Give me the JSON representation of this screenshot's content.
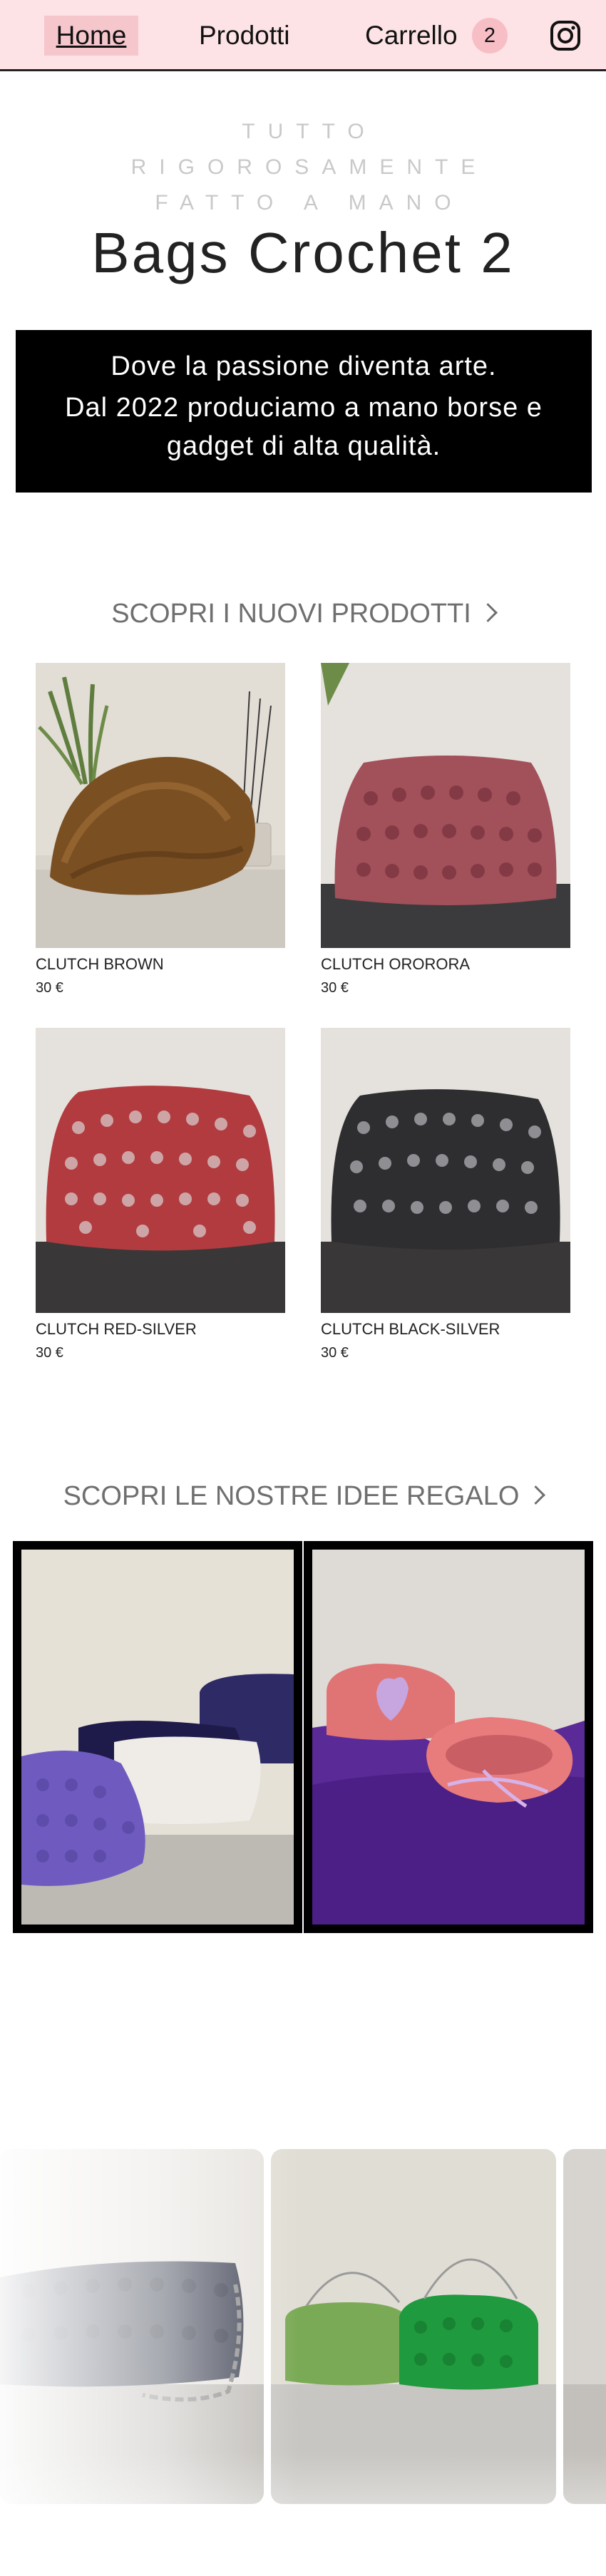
{
  "nav": {
    "home": "Home",
    "prodotti": "Prodotti",
    "carrello": "Carrello",
    "cart_count": "2",
    "instagram_icon": "instagram-icon"
  },
  "hero": {
    "tagline": [
      "TUTTO",
      "RIGOROSAMENTE",
      "FATTO A MANO"
    ],
    "title": "Bags Crochet 2"
  },
  "banner": {
    "line1": "Dove la passione diventa arte.",
    "line2": "Dal 2022 produciamo a mano borse e gadget di alta qualità."
  },
  "new_products": {
    "heading": "SCOPRI I NUOVI PRODOTTI",
    "items": [
      {
        "name": "CLUTCH BROWN",
        "price": "30 €"
      },
      {
        "name": "CLUTCH ORORORA",
        "price": "30 €"
      },
      {
        "name": "CLUTCH RED-SILVER",
        "price": "30 €"
      },
      {
        "name": "CLUTCH BLACK-SILVER",
        "price": "30 €"
      }
    ]
  },
  "gifts": {
    "heading": "SCOPRI LE NOSTRE IDEE REGALO"
  },
  "colors": {
    "header_bg": "#fde3e6",
    "active_nav_bg": "#f5c6cc",
    "badge_bg": "#f8bec6",
    "banner_bg": "#000000",
    "section_heading": "#6f6f6f"
  }
}
